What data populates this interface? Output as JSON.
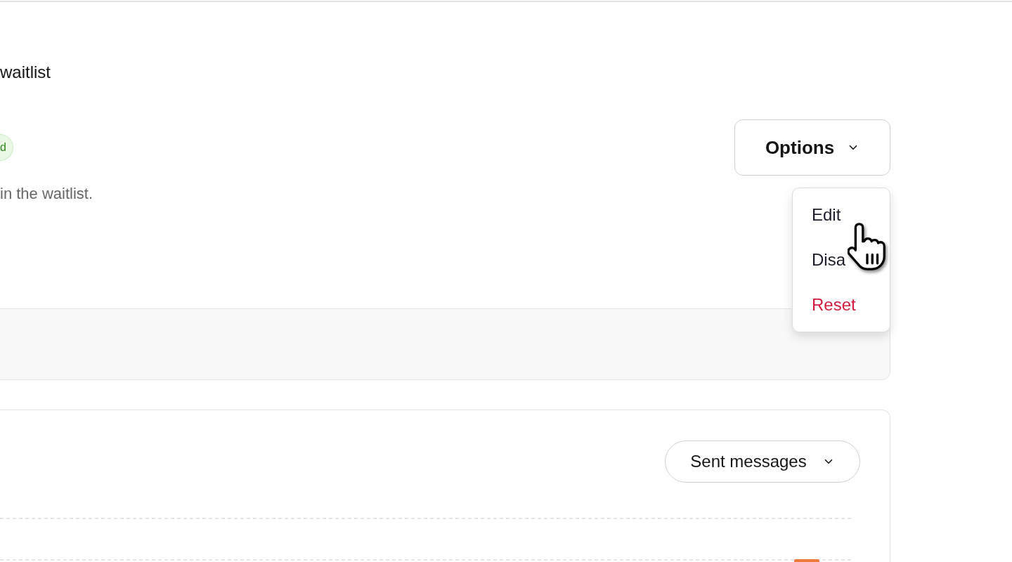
{
  "header": {
    "title": "waitlist"
  },
  "status_badge": {
    "label": "d"
  },
  "options": {
    "label": "Options",
    "expanded": true,
    "items": [
      {
        "label": "Edit",
        "kind": "normal"
      },
      {
        "label": "Disa",
        "kind": "normal"
      },
      {
        "label": "Reset",
        "kind": "danger"
      }
    ]
  },
  "description": "in the waitlist.",
  "messages_card": {
    "filter": {
      "label": "Sent messages"
    }
  }
}
